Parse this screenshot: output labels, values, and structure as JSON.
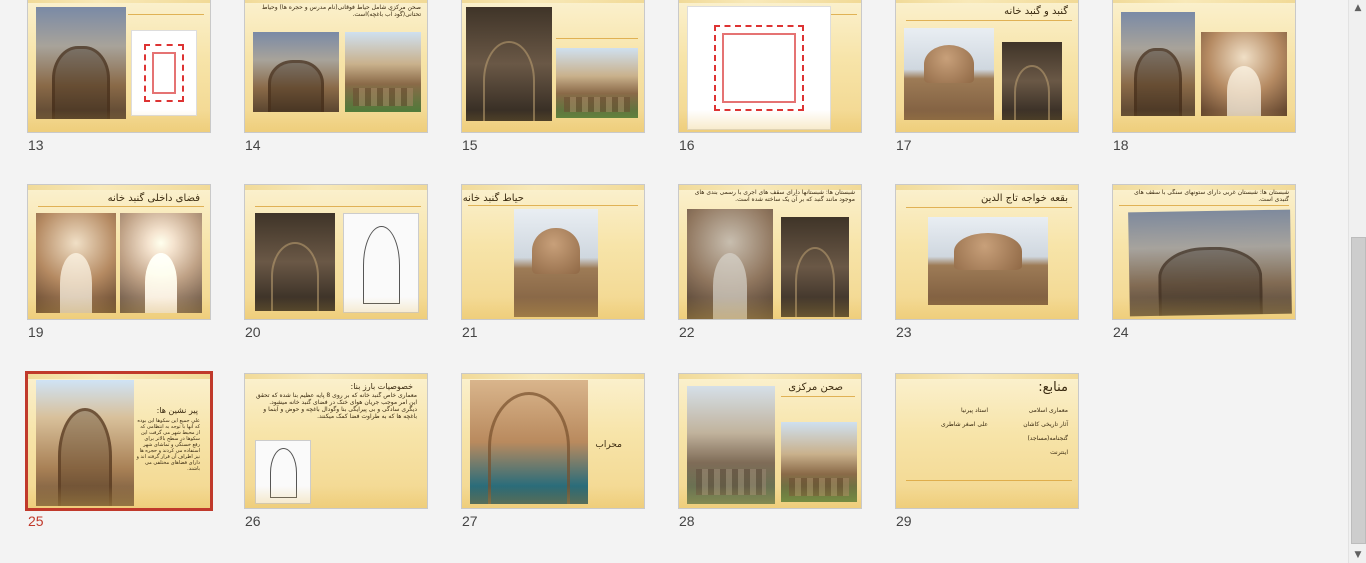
{
  "slides": {
    "s13": {
      "number": "13"
    },
    "s14": {
      "number": "14",
      "text": "صحن مرکزی شامل حیاط فوقانی(نام مدرس و حجره ها) وحیاط تحتانی(گود آب باغچه)است."
    },
    "s15": {
      "number": "15"
    },
    "s16": {
      "number": "16"
    },
    "s17": {
      "number": "17",
      "title": "گنبد و گنبد خانه"
    },
    "s18": {
      "number": "18"
    },
    "s19": {
      "number": "19",
      "title": "فضای داخلی گنبد خانه"
    },
    "s20": {
      "number": "20"
    },
    "s21": {
      "number": "21",
      "title": "حیاط گنبد خانه"
    },
    "s22": {
      "number": "22",
      "text": "شبستان ها: شبستانها دارای سقف های آجری با رسمی بندی های موجود مانند گنبد که بر آن یک ساخته شده است."
    },
    "s23": {
      "number": "23",
      "title": "بقعه خواجه تاج الدین"
    },
    "s24": {
      "number": "24",
      "text": "شبستان ها: شبستان غربی دارای ستونهای سنگی با سقف های گنبدی است."
    },
    "s25": {
      "number": "25",
      "title": "پیر نشین ها:",
      "text": "علی جمیع این سکوها این بوده که آنها با توجه به انتظامی که از محیط شهر می گرفت این سکوها در سطح بالاتر برای رفع خستگی و تماشای شهر استفاده می کردند و حجره ها نیز اطراف آن قرار گرفته اند و دارای فضاهای مختلفی می باشند."
    },
    "s26": {
      "number": "26",
      "title": "خصوصیات بارز بنا:",
      "text": "معماری خاص گنبد خانه که بر روی 8 پایه عظیم بنا شده که تحقق این امر موجب جریان هوای خنک در فضای گنبد خانه میشود. دیگری سادگی و بی پیرایگی بنا وگودال باغچه و حوض و آبنما و باغچه ها که به طراوت فضا کمک میکنند."
    },
    "s27": {
      "number": "27",
      "title": "محراب"
    },
    "s28": {
      "number": "28",
      "title": "صحن مرکزی"
    },
    "s29": {
      "number": "29",
      "title": "منابع:",
      "col_right": [
        "معماری اسلامی",
        "آثار تاریخی کاشان",
        "گنجنامه(مساجد)",
        "اینترنت"
      ],
      "col_left": [
        "استاد پیرنیا",
        "علی اصغر شاطری",
        "",
        ""
      ]
    }
  },
  "selected_slide": "25",
  "colors": {
    "selected_border": "#c0392b",
    "slide_bg": "#f7e4a9",
    "accent_rule": "#d9a23a"
  },
  "scrollbar": {
    "up_icon": "▲",
    "down_icon": "▼"
  }
}
